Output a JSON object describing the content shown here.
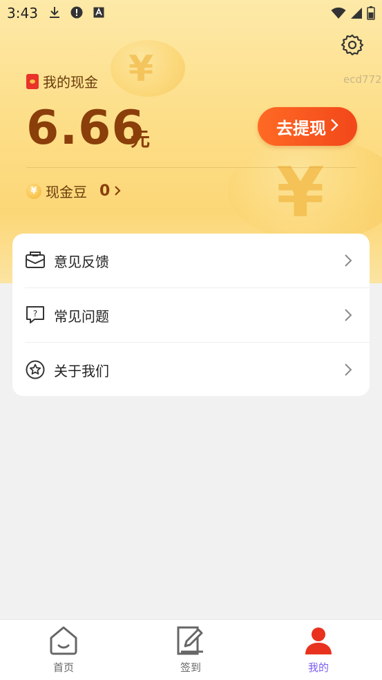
{
  "status_bar": {
    "time": "3:43",
    "left_icons": [
      "download-icon",
      "alert-icon",
      "a-text-icon"
    ],
    "right_icons": [
      "wifi-icon",
      "signal-icon",
      "battery-icon"
    ]
  },
  "header": {
    "cash_title": "我的现金",
    "user_id": "ecd772",
    "amount": "6.66",
    "amount_unit": "元",
    "withdraw_label": "去提现",
    "beans_label": "现金豆",
    "beans_count": "0",
    "bean_symbol": "¥"
  },
  "menu": {
    "items": [
      {
        "label": "意见反馈",
        "icon": "feedback-envelope-icon"
      },
      {
        "label": "常见问题",
        "icon": "faq-question-icon"
      },
      {
        "label": "关于我们",
        "icon": "about-star-icon"
      }
    ]
  },
  "bottom_nav": {
    "items": [
      {
        "label": "首页",
        "icon": "home-icon",
        "active": false
      },
      {
        "label": "签到",
        "icon": "sign-in-icon",
        "active": false
      },
      {
        "label": "我的",
        "icon": "profile-icon",
        "active": true
      }
    ]
  },
  "colors": {
    "accent_orange": "#f2471a",
    "amount_brown": "#8a3e0a",
    "nav_active": "#7b5cf0",
    "nav_inactive": "#666666"
  }
}
